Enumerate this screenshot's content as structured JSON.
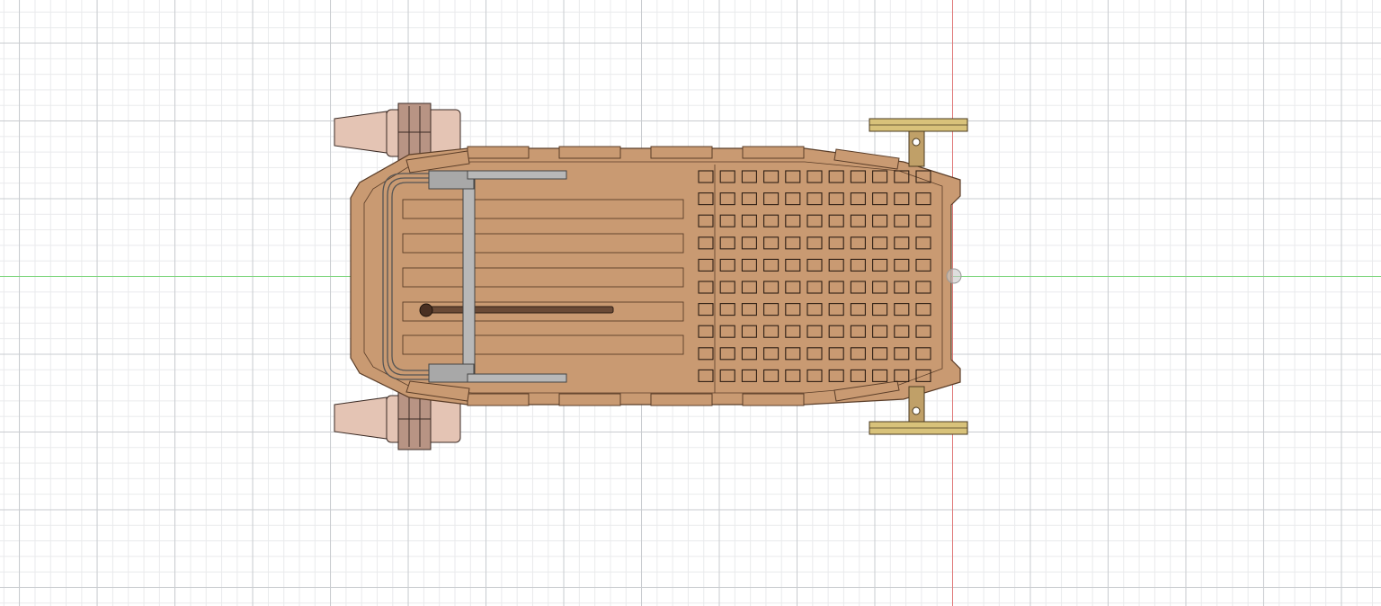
{
  "viewport": {
    "background": "#ffffff",
    "grid_major_color": "#c9ccd0",
    "grid_minor_color": "#e9eaec",
    "x_axis_color": "#7fd67f",
    "y_axis_color": "#e07a7a"
  },
  "model": {
    "deck_color": "#c99a72",
    "deck_edge_color": "#5a3d28",
    "engine_color": "#e4c4b4",
    "engine_band_color": "#b89484",
    "railing_color": "#b8b8b8",
    "steering_vane_color": "#d8c27a",
    "strut_color": "#c0a068",
    "pole_color": "#6a4a36",
    "slot_rows": 10,
    "slot_cols": 11,
    "plank_count": 5
  }
}
